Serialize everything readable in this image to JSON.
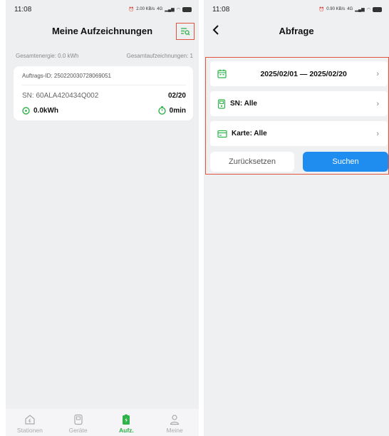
{
  "left": {
    "status": {
      "time": "11:08",
      "net_speed": "2.00 KB/s",
      "signal": "4G",
      "battery": ""
    },
    "header": {
      "title": "Meine Aufzeichnungen"
    },
    "summary": {
      "energy": "Gesamtenergie: 0.0 kWh",
      "count": "Gesamtaufzeichnungen: 1"
    },
    "records": [
      {
        "order_id": "Auftrags-ID: 250220030728069051",
        "sn": "SN: 60ALA420434Q002",
        "date": "02/20",
        "energy": "0.0kWh",
        "duration": "0min"
      }
    ],
    "tabs": [
      {
        "label": "Stationen",
        "icon": "station-icon",
        "active": false
      },
      {
        "label": "Geräte",
        "icon": "device-icon",
        "active": false
      },
      {
        "label": "Aufz.",
        "icon": "records-icon",
        "active": true
      },
      {
        "label": "Meine",
        "icon": "profile-icon",
        "active": false
      }
    ]
  },
  "right": {
    "status": {
      "time": "11:08",
      "net_speed": "0.90 KB/s",
      "signal": "4G",
      "battery": ""
    },
    "header": {
      "title": "Abfrage"
    },
    "query": {
      "date_range": "2025/02/01 — 2025/02/20",
      "sn": "SN:  Alle",
      "card": "Karte:  Alle"
    },
    "buttons": {
      "reset": "Zurücksetzen",
      "search": "Suchen"
    }
  },
  "colors": {
    "accent_green": "#2fb24a",
    "highlight_red": "#e0533f",
    "primary_blue": "#1f8cf0"
  }
}
